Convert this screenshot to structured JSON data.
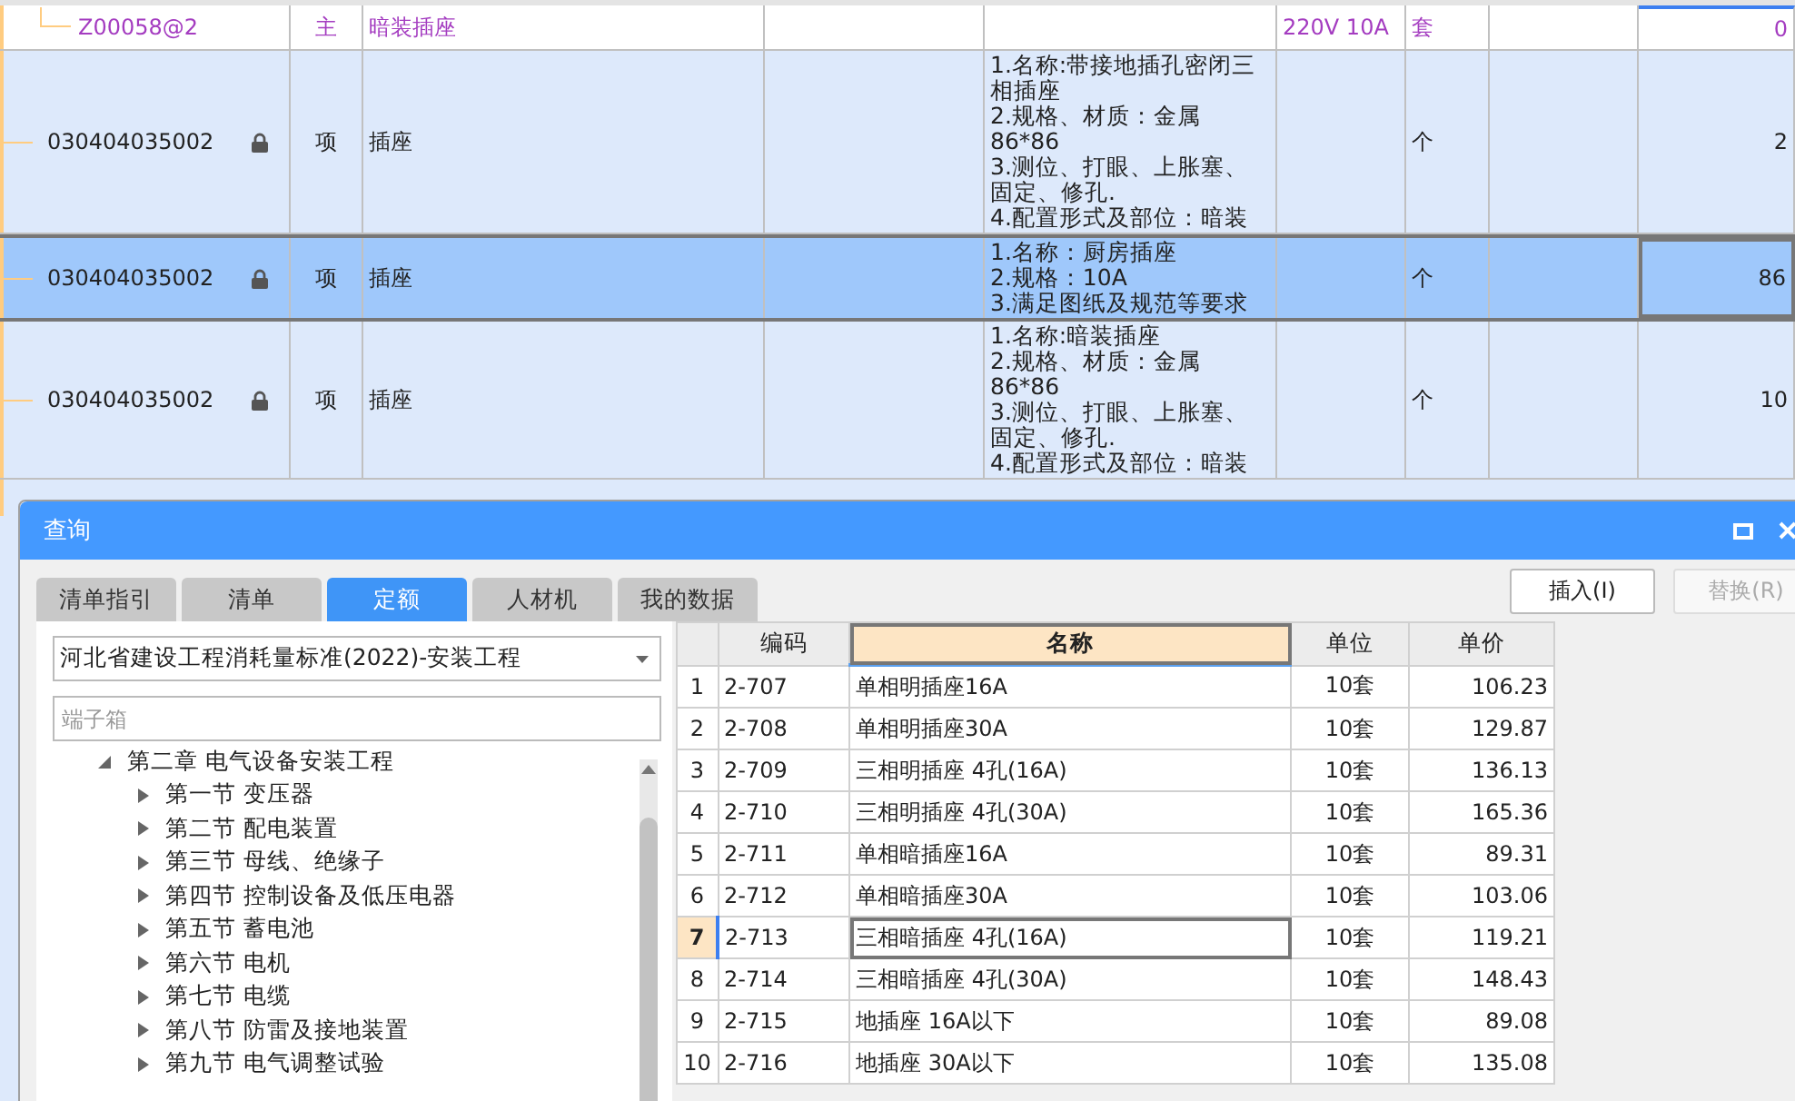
{
  "grid": {
    "rows": [
      {
        "kind": "material",
        "code": "Z00058@2",
        "type": "主",
        "name": "暗装插座",
        "desc": [],
        "spec": "220V 10A",
        "unit": "套",
        "qty": "0",
        "locked": false,
        "selected": false
      },
      {
        "kind": "item",
        "code": "030404035002",
        "type": "项",
        "name": "插座",
        "desc": [
          "1.名称:带接地插孔密闭三相插座",
          "2.规格、材质：金属 86*86",
          "3.测位、打眼、上胀塞、固定、修孔.",
          "4.配置形式及部位：暗装"
        ],
        "spec": "",
        "unit": "个",
        "qty": "2",
        "locked": true,
        "selected": false
      },
      {
        "kind": "item",
        "code": "030404035002",
        "type": "项",
        "name": "插座",
        "desc": [
          "1.名称：厨房插座",
          "2.规格：10A",
          "3.满足图纸及规范等要求"
        ],
        "spec": "",
        "unit": "个",
        "qty": "86",
        "locked": true,
        "selected": true
      },
      {
        "kind": "item",
        "code": "030404035002",
        "type": "项",
        "name": "插座",
        "desc": [
          "1.名称:暗装插座",
          "2.规格、材质：金属 86*86",
          "3.测位、打眼、上胀塞、固定、修孔.",
          "4.配置形式及部位：暗装"
        ],
        "spec": "",
        "unit": "个",
        "qty": "10",
        "locked": true,
        "selected": false
      }
    ]
  },
  "dialog": {
    "title": "查询",
    "tabs": [
      {
        "label": "清单指引",
        "selected": false
      },
      {
        "label": "清单",
        "selected": false
      },
      {
        "label": "定额",
        "selected": true
      },
      {
        "label": "人材机",
        "selected": false
      },
      {
        "label": "我的数据",
        "selected": false
      }
    ],
    "buttons": [
      {
        "label": "插入(I)",
        "disabled": false
      },
      {
        "label": "替换(R)",
        "disabled": true
      }
    ],
    "library": {
      "value": "河北省建设工程消耗量标准(2022)-安装工程"
    },
    "search": {
      "placeholder": "端子箱"
    },
    "tree": [
      {
        "label": "第二章 电气设备安装工程",
        "expanded": true,
        "children": [
          {
            "label": "第一节 变压器",
            "expanded": false
          },
          {
            "label": "第二节 配电装置",
            "expanded": false
          },
          {
            "label": "第三节 母线、绝缘子",
            "expanded": false
          },
          {
            "label": "第四节 控制设备及低压电器",
            "expanded": false
          },
          {
            "label": "第五节 蓄电池",
            "expanded": false
          },
          {
            "label": "第六节 电机",
            "expanded": false
          },
          {
            "label": "第七节 电缆",
            "expanded": false
          },
          {
            "label": "第八节 防雷及接地装置",
            "expanded": false
          },
          {
            "label": "第九节 电气调整试验",
            "expanded": false
          }
        ]
      }
    ],
    "table": {
      "columns": [
        {
          "label": "编码",
          "selected": false
        },
        {
          "label": "名称",
          "selected": true
        },
        {
          "label": "单位",
          "selected": false
        },
        {
          "label": "单价",
          "selected": false
        }
      ],
      "rows": [
        {
          "index": "1",
          "code": "2-707",
          "name": "单相明插座16A",
          "unit": "10套",
          "price": "106.23",
          "selected": false
        },
        {
          "index": "2",
          "code": "2-708",
          "name": "单相明插座30A",
          "unit": "10套",
          "price": "129.87",
          "selected": false
        },
        {
          "index": "3",
          "code": "2-709",
          "name": "三相明插座 4孔(16A)",
          "unit": "10套",
          "price": "136.13",
          "selected": false
        },
        {
          "index": "4",
          "code": "2-710",
          "name": "三相明插座 4孔(30A)",
          "unit": "10套",
          "price": "165.36",
          "selected": false
        },
        {
          "index": "5",
          "code": "2-711",
          "name": "单相暗插座16A",
          "unit": "10套",
          "price": "89.31",
          "selected": false
        },
        {
          "index": "6",
          "code": "2-712",
          "name": "单相暗插座30A",
          "unit": "10套",
          "price": "103.06",
          "selected": false
        },
        {
          "index": "7",
          "code": "2-713",
          "name": "三相暗插座 4孔(16A)",
          "unit": "10套",
          "price": "119.21",
          "selected": true
        },
        {
          "index": "8",
          "code": "2-714",
          "name": "三相暗插座 4孔(30A)",
          "unit": "10套",
          "price": "148.43",
          "selected": false
        },
        {
          "index": "9",
          "code": "2-715",
          "name": "地插座 16A以下",
          "unit": "10套",
          "price": "89.08",
          "selected": false
        },
        {
          "index": "10",
          "code": "2-716",
          "name": "地插座 30A以下",
          "unit": "10套",
          "price": "135.08",
          "selected": false
        }
      ]
    }
  }
}
